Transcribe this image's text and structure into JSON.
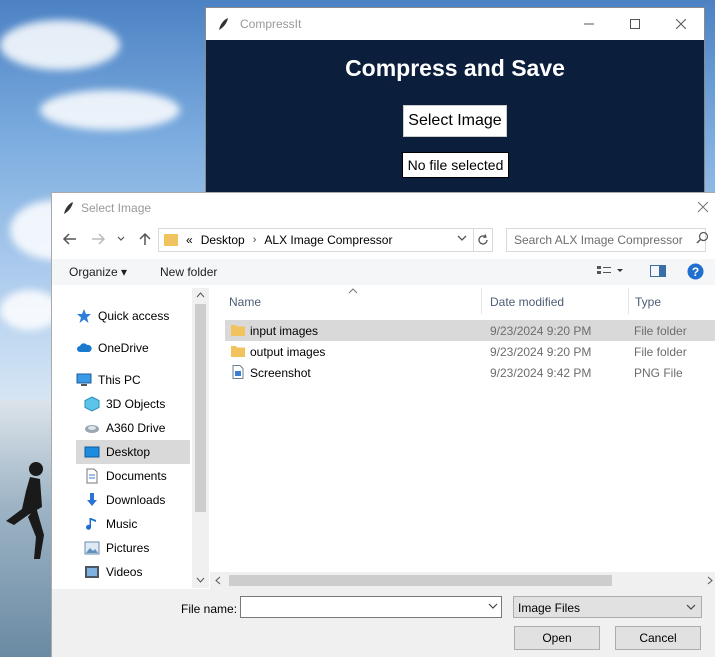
{
  "app_window": {
    "title": "CompressIt",
    "heading": "Compress and Save",
    "select_button": "Select Image",
    "file_status": "No file selected"
  },
  "dialog": {
    "title": "Select Image",
    "address": {
      "overflow": "«",
      "crumbs": [
        "Desktop",
        "ALX Image Compressor"
      ]
    },
    "search_placeholder": "Search ALX Image Compressor",
    "toolbar": {
      "organize": "Organize ▾",
      "new_folder": "New folder"
    },
    "nav_items": [
      {
        "label": "Quick access",
        "icon": "star-icon"
      },
      {
        "label": "OneDrive",
        "icon": "cloud-icon"
      },
      {
        "label": "This PC",
        "icon": "computer-icon"
      },
      {
        "label": "3D Objects",
        "icon": "cube-icon"
      },
      {
        "label": "A360 Drive",
        "icon": "drive-icon"
      },
      {
        "label": "Desktop",
        "icon": "desktop-icon"
      },
      {
        "label": "Documents",
        "icon": "document-icon"
      },
      {
        "label": "Downloads",
        "icon": "download-icon"
      },
      {
        "label": "Music",
        "icon": "music-icon"
      },
      {
        "label": "Pictures",
        "icon": "picture-icon"
      },
      {
        "label": "Videos",
        "icon": "video-icon"
      }
    ],
    "columns": [
      "Name",
      "Date modified",
      "Type"
    ],
    "files": [
      {
        "name": "input images",
        "date": "9/23/2024 9:20 PM",
        "type": "File folder",
        "icon": "folder-icon"
      },
      {
        "name": "output images",
        "date": "9/23/2024 9:20 PM",
        "type": "File folder",
        "icon": "folder-icon"
      },
      {
        "name": "Screenshot",
        "date": "9/23/2024 9:42 PM",
        "type": "PNG File",
        "icon": "png-file-icon"
      }
    ],
    "file_name_label": "File name:",
    "file_name_value": "",
    "file_type": "Image Files",
    "open_button": "Open",
    "cancel_button": "Cancel"
  },
  "colors": {
    "app_bg": "#0b1e3b",
    "folder": "#f1c35f",
    "selected_row": "#d9d9d9",
    "help": "#1f6fd1"
  }
}
